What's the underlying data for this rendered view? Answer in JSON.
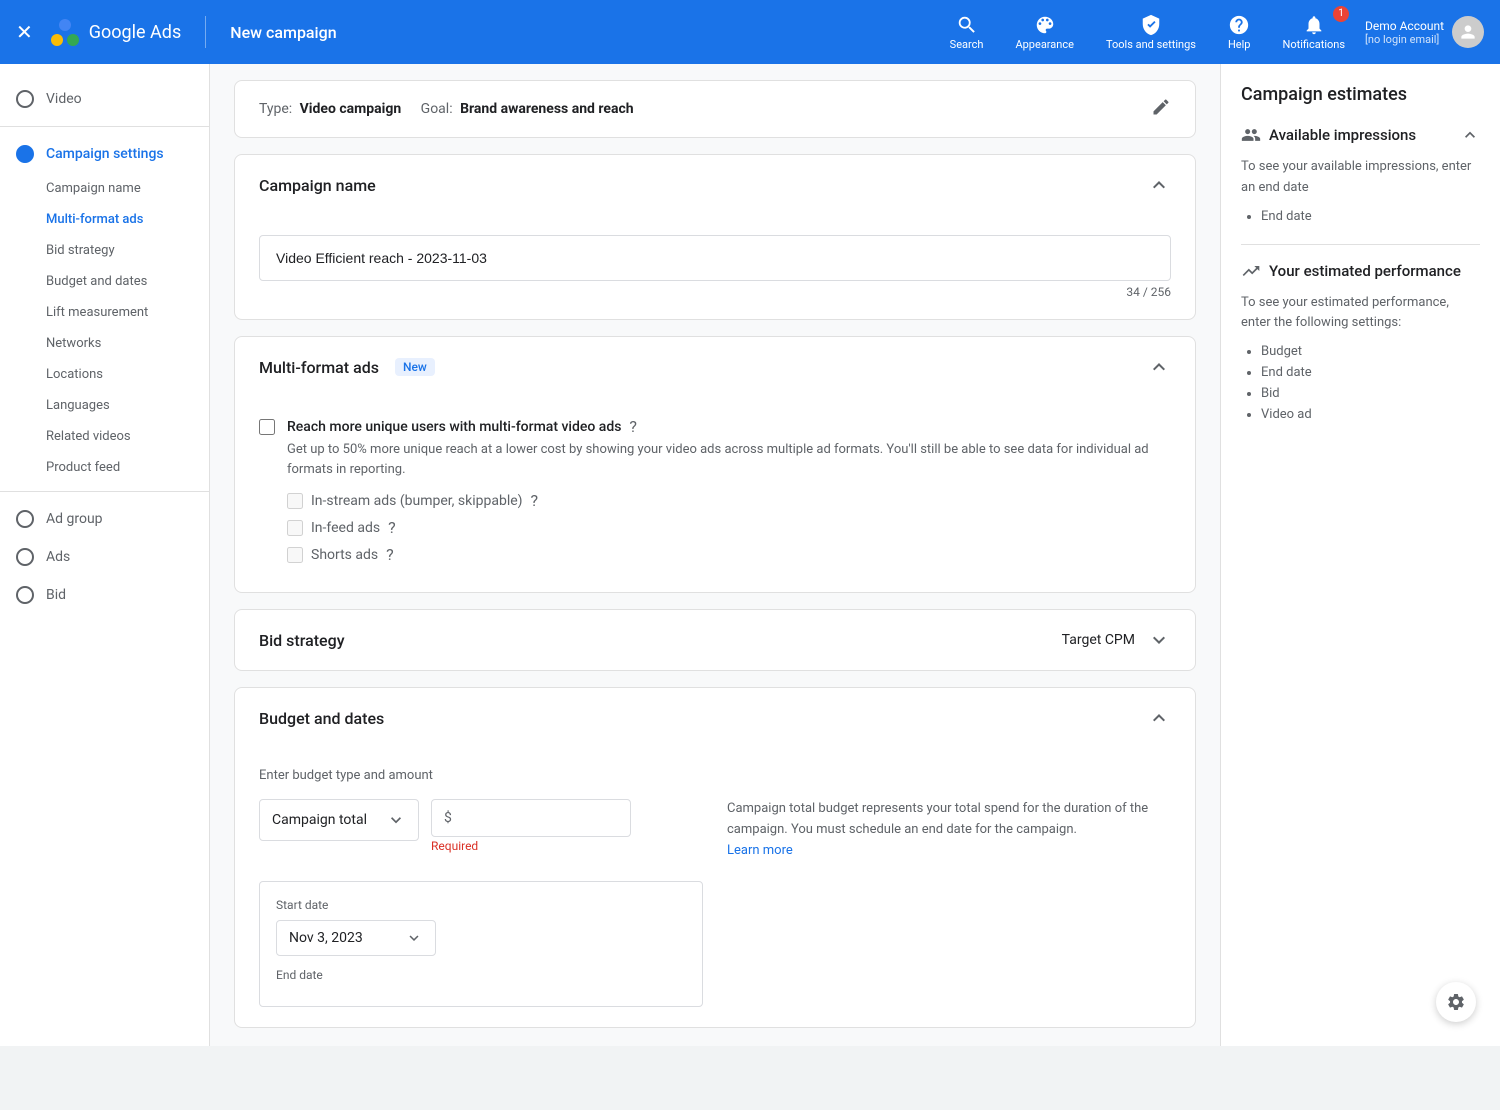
{
  "topbar": {
    "brand": "Google Ads",
    "divider": "|",
    "title": "New campaign",
    "actions": [
      {
        "id": "search",
        "label": "Search"
      },
      {
        "id": "appearance",
        "label": "Appearance"
      },
      {
        "id": "tools",
        "label": "Tools and settings"
      },
      {
        "id": "help",
        "label": "Help"
      },
      {
        "id": "notifications",
        "label": "Notifications",
        "badge": "1"
      }
    ],
    "user": {
      "name": "Demo Account",
      "email": "[no login email]"
    }
  },
  "sidebar": {
    "top_section": {
      "icon_type": "circle",
      "label": "Video"
    },
    "sections": [
      {
        "id": "campaign-settings",
        "label": "Campaign settings",
        "type": "circle-active"
      },
      {
        "id": "campaign-name",
        "label": "Campaign name",
        "type": "sub"
      },
      {
        "id": "multi-format-ads",
        "label": "Multi-format ads",
        "type": "sub-active"
      },
      {
        "id": "bid-strategy",
        "label": "Bid strategy",
        "type": "sub"
      },
      {
        "id": "budget-dates",
        "label": "Budget and dates",
        "type": "sub"
      },
      {
        "id": "lift-measurement",
        "label": "Lift measurement",
        "type": "sub"
      },
      {
        "id": "networks",
        "label": "Networks",
        "type": "sub"
      },
      {
        "id": "locations",
        "label": "Locations",
        "type": "sub"
      },
      {
        "id": "languages",
        "label": "Languages",
        "type": "sub"
      },
      {
        "id": "related-videos",
        "label": "Related videos",
        "type": "sub"
      },
      {
        "id": "product-feed",
        "label": "Product feed",
        "type": "sub"
      }
    ],
    "bottom_sections": [
      {
        "id": "ad-group",
        "label": "Ad group",
        "type": "circle"
      },
      {
        "id": "ads",
        "label": "Ads",
        "type": "circle"
      },
      {
        "id": "bid",
        "label": "Bid",
        "type": "circle"
      }
    ]
  },
  "type_goal_bar": {
    "type_label": "Type:",
    "type_value": "Video campaign",
    "goal_label": "Goal:",
    "goal_value": "Brand awareness and reach"
  },
  "campaign_name_section": {
    "title": "Campaign name",
    "input_value": "Video Efficient reach - 2023-11-03",
    "char_count": "34 / 256"
  },
  "multi_format_section": {
    "title": "Multi-format ads",
    "badge": "New",
    "checkbox_label": "Reach more unique users with multi-format video ads",
    "checkbox_desc": "Get up to 50% more unique reach at a lower cost by showing your video ads across multiple ad formats. You'll still be able to see data for individual ad formats in reporting.",
    "sub_options": [
      {
        "id": "in-stream",
        "label": "In-stream ads (bumper, skippable)"
      },
      {
        "id": "in-feed",
        "label": "In-feed ads"
      },
      {
        "id": "shorts",
        "label": "Shorts ads"
      }
    ]
  },
  "bid_strategy_section": {
    "title": "Bid strategy",
    "value": "Target CPM"
  },
  "budget_section": {
    "title": "Budget and dates",
    "enter_label": "Enter budget type and amount",
    "budget_type": "Campaign total",
    "currency_symbol": "$",
    "required_text": "Required",
    "description": "Campaign total budget represents your total spend for the duration of the campaign. You must schedule an end date for the campaign.",
    "learn_more": "Learn more",
    "start_date_label": "Start date",
    "start_date_value": "Nov 3, 2023",
    "end_date_label": "End date"
  },
  "right_panel": {
    "title": "Campaign estimates",
    "available_impressions": {
      "title": "Available impressions",
      "desc": "To see your available impressions, enter an end date",
      "list": [
        "End date"
      ]
    },
    "estimated_performance": {
      "title": "Your estimated performance",
      "desc": "To see your estimated performance, enter the following settings:",
      "list": [
        "Budget",
        "End date",
        "Bid",
        "Video ad"
      ]
    }
  }
}
